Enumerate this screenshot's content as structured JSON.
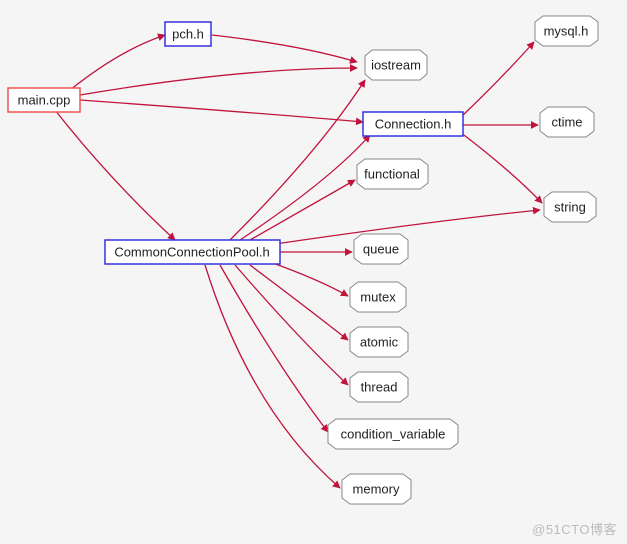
{
  "colors": {
    "edge": "#c0143c",
    "red": "#e55",
    "blue": "#33d",
    "grey": "#888"
  },
  "nodes": {
    "main": {
      "label": "main.cpp"
    },
    "pch": {
      "label": "pch.h"
    },
    "pool": {
      "label": "CommonConnectionPool.h"
    },
    "conn": {
      "label": "Connection.h"
    },
    "iostream": {
      "label": "iostream"
    },
    "mysql": {
      "label": "mysql.h"
    },
    "ctime": {
      "label": "ctime"
    },
    "functional": {
      "label": "functional"
    },
    "string": {
      "label": "string"
    },
    "queue": {
      "label": "queue"
    },
    "mutex": {
      "label": "mutex"
    },
    "atomic": {
      "label": "atomic"
    },
    "thread": {
      "label": "thread"
    },
    "condvar": {
      "label": "condition_variable"
    },
    "memory": {
      "label": "memory"
    }
  },
  "edges": [
    [
      "main",
      "pch"
    ],
    [
      "main",
      "iostream"
    ],
    [
      "main",
      "conn"
    ],
    [
      "main",
      "pool"
    ],
    [
      "pch",
      "iostream"
    ],
    [
      "conn",
      "mysql"
    ],
    [
      "conn",
      "ctime"
    ],
    [
      "conn",
      "string"
    ],
    [
      "pool",
      "iostream"
    ],
    [
      "pool",
      "conn"
    ],
    [
      "pool",
      "functional"
    ],
    [
      "pool",
      "string"
    ],
    [
      "pool",
      "queue"
    ],
    [
      "pool",
      "mutex"
    ],
    [
      "pool",
      "atomic"
    ],
    [
      "pool",
      "thread"
    ],
    [
      "pool",
      "condvar"
    ],
    [
      "pool",
      "memory"
    ]
  ],
  "watermark": "@51CTO博客"
}
